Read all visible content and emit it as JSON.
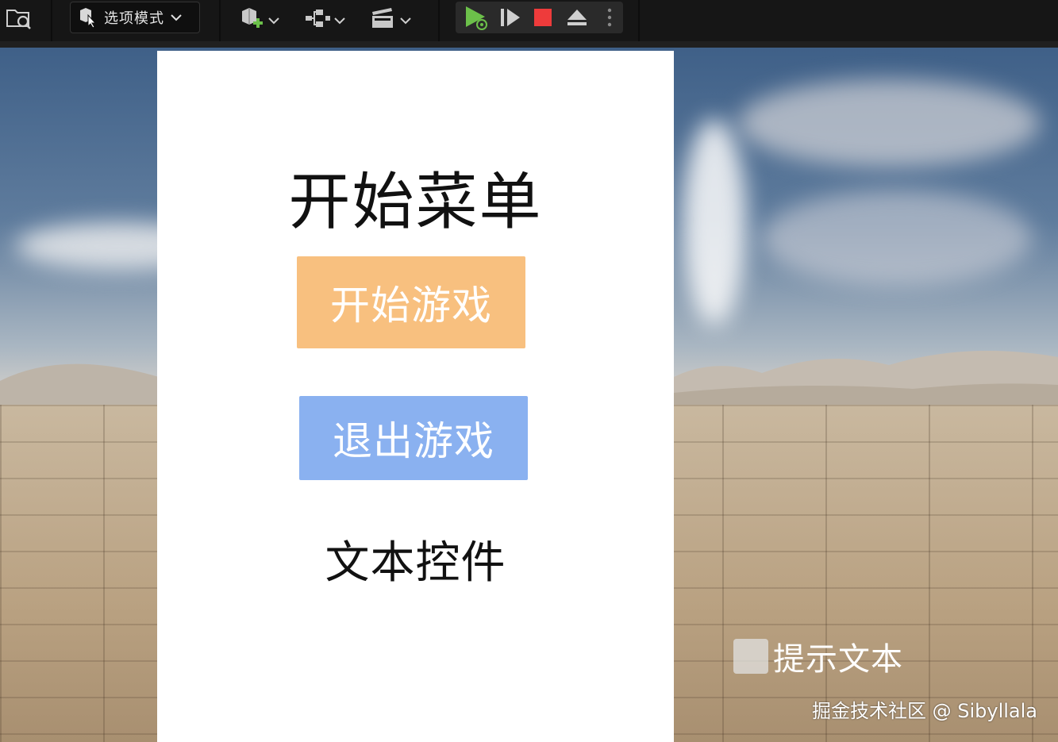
{
  "toolbar": {
    "content_browser_icon": "folder-search-icon",
    "mode_button": {
      "icon": "select-cursor-icon",
      "label": "选项模式"
    },
    "add_actor_icon": "add-actor-icon",
    "blueprint_icon": "blueprint-icon",
    "cinematics_icon": "clapperboard-icon",
    "play_controls": {
      "play_icon": "play-icon",
      "advance_icon": "frame-advance-icon",
      "stop_icon": "stop-icon",
      "eject_icon": "eject-icon",
      "more_icon": "more-vertical-icon"
    },
    "colors": {
      "play": "#6cc04a",
      "stop": "#ee3b3b",
      "bg": "#161616"
    }
  },
  "viewport": {
    "menu": {
      "title": "开始菜单",
      "start_button": {
        "label": "开始游戏",
        "color": "#f8c07f"
      },
      "quit_button": {
        "label": "退出游戏",
        "color": "#8ab1f0"
      },
      "text_widget": "文本控件"
    },
    "hint": {
      "label": "提示文本"
    },
    "watermark": "掘金技术社区 @ Sibyllala"
  }
}
